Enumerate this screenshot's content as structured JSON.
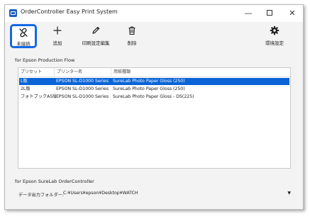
{
  "window": {
    "title": "OrderController Easy Print System",
    "controls": {
      "minimize": "—",
      "close": "✕"
    }
  },
  "toolbar": {
    "disconnect_label": "未接続",
    "add_label": "追加",
    "edit_label": "印刷設定編集",
    "delete_label": "削除",
    "env_label": "環境設定",
    "accent": "#1468e6"
  },
  "production_flow": {
    "group_label": "for Epson Production Flow",
    "columns": [
      "プリセット",
      "プリンター名",
      "用紙種類"
    ],
    "rows": [
      {
        "preset": "L版",
        "printer": "EPSON SL-D1000 Series",
        "paper": "SureLab Photo Paper Gloss (250)",
        "selected": true
      },
      {
        "preset": "2L版",
        "printer": "EPSON SL-D1000 Series",
        "paper": "SureLab Photo Paper Gloss (250)",
        "selected": false
      },
      {
        "preset": "フォトブックA5縦",
        "printer": "EPSON SL-D1000 Series",
        "paper": "SureLab Photo Paper Gloss - DS(225)",
        "selected": false
      }
    ],
    "selection_color": "#0a64d6"
  },
  "order_controller": {
    "group_label": "for Epson SureLab OrderController",
    "folder_label": "データ出力フォルダー:",
    "folder_value": "C:¥Users¥epson¥Desktop¥WATCH",
    "dropdown_arrow": "▼"
  },
  "icons": {
    "disconnect": "unlink-icon",
    "add": "plus-icon",
    "edit": "pencil-icon",
    "delete": "trash-icon",
    "env": "gear-icon"
  }
}
